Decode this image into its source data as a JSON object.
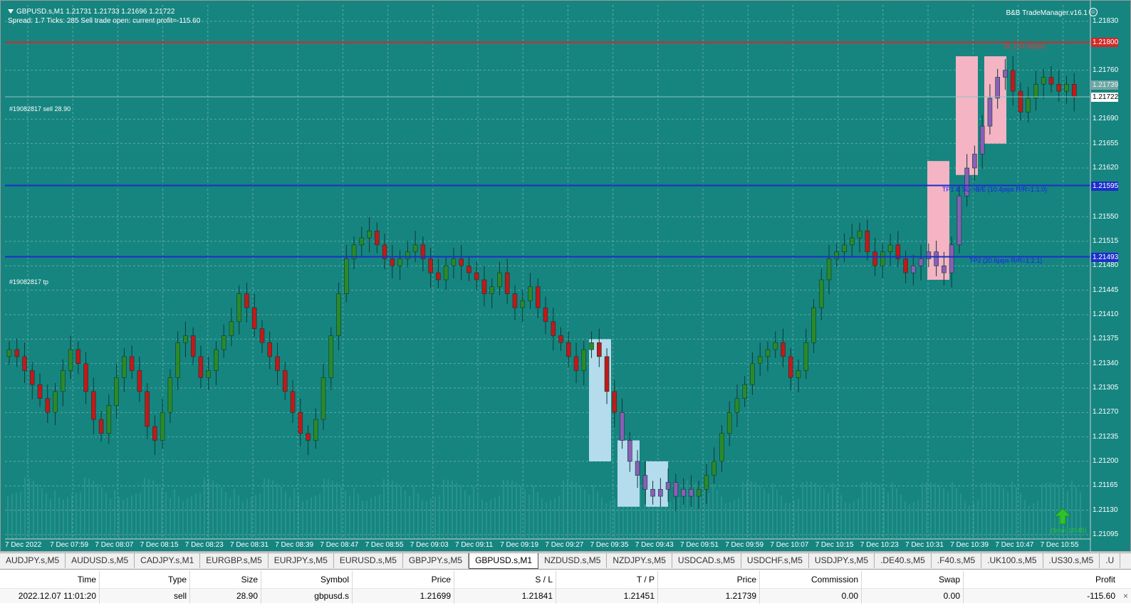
{
  "chart": {
    "symbol_info": "GBPUSD.s,M1  1.21731 1.21733 1.21696 1.21722",
    "status_line": "Spread: 1.7   Ticks: 285   Sell trade open: current profit=-115.60",
    "trade_manager_title": "B&B TradeManager.v16.1",
    "order_sell_label": "#19082817 sell 28.90",
    "order_tp_label": "#19082817 tp",
    "sl_label": "SL (10.0pips)",
    "tp1_label": "TP1 & SL->B/E (10.4pips R/R=1:1.0)",
    "tp2_label": "TP2 (20.6pips R/R=1:2.1)",
    "timer_label": "(5min 10:45)",
    "price_levels": {
      "sl": "1.21800",
      "tp1": "1.21595",
      "tp2": "1.21493",
      "bid_gray": "1.21739",
      "bid": "1.21722"
    },
    "price_ticks": [
      "1.21830",
      "1.21760",
      "1.21690",
      "1.21655",
      "1.21620",
      "1.21550",
      "1.21515",
      "1.21480",
      "1.21445",
      "1.21410",
      "1.21375",
      "1.21340",
      "1.21305",
      "1.21270",
      "1.21235",
      "1.21200",
      "1.21165",
      "1.21130",
      "1.21095"
    ],
    "time_ticks": [
      "7 Dec 2022",
      "7 Dec 07:59",
      "7 Dec 08:07",
      "7 Dec 08:15",
      "7 Dec 08:23",
      "7 Dec 08:31",
      "7 Dec 08:39",
      "7 Dec 08:47",
      "7 Dec 08:55",
      "7 Dec 09:03",
      "7 Dec 09:11",
      "7 Dec 09:19",
      "7 Dec 09:27",
      "7 Dec 09:35",
      "7 Dec 09:43",
      "7 Dec 09:51",
      "7 Dec 09:59",
      "7 Dec 10:07",
      "7 Dec 10:15",
      "7 Dec 10:23",
      "7 Dec 10:31",
      "7 Dec 10:39",
      "7 Dec 10:47",
      "7 Dec 10:55"
    ],
    "colors": {
      "background": "#168580",
      "grid": "#5fa8a4",
      "bull": "#2a8a2a",
      "bear": "#c41818",
      "sl_line": "#d12a2a",
      "tp_line": "#1b2fc9",
      "supply_zone": "#f4b4c4",
      "demand_zone": "#b4dcec",
      "highlight_candle": "#8a5fb5"
    }
  },
  "symbol_tabs": [
    "AUDJPY.s,M5",
    "AUDUSD.s,M5",
    "CADJPY.s,M1",
    "EURGBP.s,M5",
    "EURJPY.s,M5",
    "EURUSD.s,M5",
    "GBPJPY.s,M5",
    "GBPUSD.s,M1",
    "NZDUSD.s,M5",
    "NZDJPY.s,M5",
    "USDCAD.s,M5",
    "USDCHF.s,M5",
    "USDJPY.s,M5",
    ".DE40.s,M5",
    ".F40.s,M5",
    ".UK100.s,M5",
    ".US30.s,M5",
    ".U"
  ],
  "active_tab_index": 7,
  "trade_table": {
    "headers": {
      "time": "Time",
      "type": "Type",
      "size": "Size",
      "symbol": "Symbol",
      "price": "Price",
      "sl": "S / L",
      "tp": "T / P",
      "price2": "Price",
      "commission": "Commission",
      "swap": "Swap",
      "profit": "Profit"
    },
    "row": {
      "time": "2022.12.07 11:01:20",
      "type": "sell",
      "size": "28.90",
      "symbol": "gbpusd.s",
      "price": "1.21699",
      "sl": "1.21841",
      "tp": "1.21451",
      "price2": "1.21739",
      "commission": "0.00",
      "swap": "0.00",
      "profit": "-115.60"
    },
    "close_glyph": "×"
  }
}
